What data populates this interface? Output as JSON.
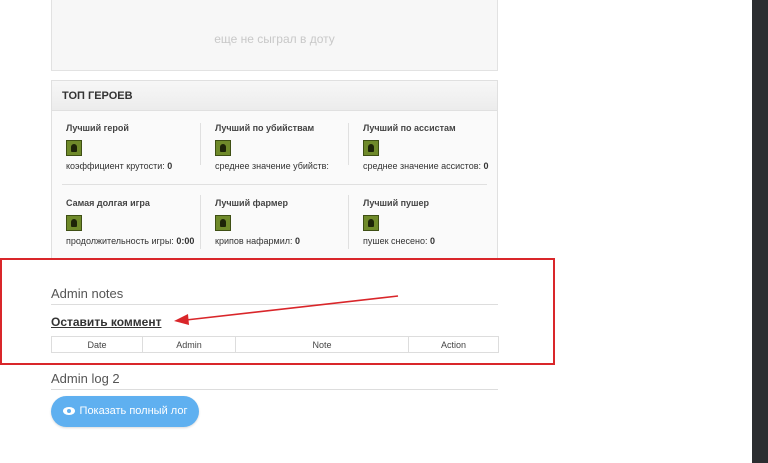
{
  "empty_state": {
    "message": "еще не сыграл в доту"
  },
  "top_heroes": {
    "title": "ТОП ГЕРОЕВ",
    "stats": [
      {
        "title": "Лучший герой",
        "label": "коэффициент крутости:",
        "value": "0"
      },
      {
        "title": "Лучший по убийствам",
        "label": "среднее значение убийств:",
        "value": ""
      },
      {
        "title": "Лучший по ассистам",
        "label": "среднее значение ассистов:",
        "value": "0"
      },
      {
        "title": "Самая долгая игра",
        "label": "продолжительность игры:",
        "value": "0:00"
      },
      {
        "title": "Лучший фармер",
        "label": "крипов нафармил:",
        "value": "0"
      },
      {
        "title": "Лучший пушер",
        "label": "пушек снесено:",
        "value": "0"
      }
    ]
  },
  "admin_notes": {
    "title": "Admin notes",
    "link": "Оставить коммент",
    "columns": [
      "Date",
      "Admin",
      "Note",
      "Action"
    ]
  },
  "admin_log": {
    "title": "Admin log 2",
    "button_label": "Показать полный лог",
    "button_icon": "eye-icon"
  },
  "colors": {
    "highlight": "#d9262a",
    "button": "#5fb0f0"
  }
}
